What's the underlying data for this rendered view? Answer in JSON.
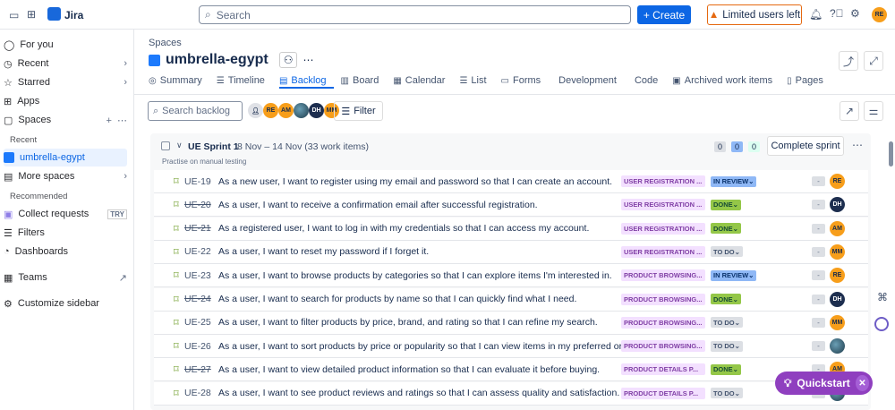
{
  "topbar": {
    "app": "Jira",
    "search_placeholder": "Search",
    "create": "Create",
    "limited": "Limited users left",
    "user_initials": "RE"
  },
  "sidebar": {
    "items": [
      {
        "label": "For you"
      },
      {
        "label": "Recent"
      },
      {
        "label": "Starred"
      },
      {
        "label": "Apps"
      },
      {
        "label": "Spaces"
      }
    ],
    "recent_header": "Recent",
    "space": "umbrella-egypt",
    "more_spaces": "More spaces",
    "recommended_header": "Recommended",
    "collect": "Collect requests",
    "try": "TRY",
    "filters": "Filters",
    "dashboards": "Dashboards",
    "teams": "Teams",
    "customize": "Customize sidebar"
  },
  "header": {
    "breadcrumb": "Spaces",
    "title": "umbrella-egypt"
  },
  "tabs": [
    {
      "label": "Summary"
    },
    {
      "label": "Timeline"
    },
    {
      "label": "Backlog"
    },
    {
      "label": "Board"
    },
    {
      "label": "Calendar"
    },
    {
      "label": "List"
    },
    {
      "label": "Forms"
    },
    {
      "label": "Development"
    },
    {
      "label": "Code"
    },
    {
      "label": "Archived work items"
    },
    {
      "label": "Pages"
    }
  ],
  "toolbar": {
    "search_placeholder": "Search backlog",
    "filter": "Filter",
    "avatars": [
      "RE",
      "AM",
      "",
      "DH",
      "MM"
    ]
  },
  "sprint": {
    "name": "UE Sprint 1",
    "dates": "8 Nov – 14 Nov (33 work items)",
    "goal": "Practise on manual testing",
    "counts": [
      "0",
      "0",
      "0"
    ],
    "complete": "Complete sprint"
  },
  "issues": [
    {
      "key": "UE-19",
      "summary": "As a new user, I want to register using my email and password so that I can create an account.",
      "epic": "USER REGISTRATION ...",
      "status": "IN REVIEW",
      "est": "-",
      "assignee": "RE",
      "done": false
    },
    {
      "key": "UE-20",
      "summary": "As a user, I want to receive a confirmation email after successful registration.",
      "epic": "USER REGISTRATION ...",
      "status": "DONE",
      "est": "-",
      "assignee": "DH",
      "done": true
    },
    {
      "key": "UE-21",
      "summary": "As a registered user, I want to log in with my credentials so that I can access my account.",
      "epic": "USER REGISTRATION ...",
      "status": "DONE",
      "est": "-",
      "assignee": "AM",
      "done": true
    },
    {
      "key": "UE-22",
      "summary": "As a user, I want to reset my password if I forget it.",
      "epic": "USER REGISTRATION ...",
      "status": "TO DO",
      "est": "-",
      "assignee": "MM",
      "done": false
    },
    {
      "key": "UE-23",
      "summary": "As a user, I want to browse products by categories so that I can explore items I'm interested in.",
      "epic": "PRODUCT BROWSING...",
      "status": "IN REVIEW",
      "est": "-",
      "assignee": "RE",
      "done": false
    },
    {
      "key": "UE-24",
      "summary": "As a user, I want to search for products by name so that I can quickly find what I need.",
      "epic": "PRODUCT BROWSING...",
      "status": "DONE",
      "est": "-",
      "assignee": "DH",
      "done": true
    },
    {
      "key": "UE-25",
      "summary": "As a user, I want to filter products by price, brand, and rating so that I can refine my search.",
      "epic": "PRODUCT BROWSING...",
      "status": "TO DO",
      "est": "-",
      "assignee": "MM",
      "done": false
    },
    {
      "key": "UE-26",
      "summary": "As a user, I want to sort products by price or popularity so that I can view items in my preferred or...",
      "epic": "PRODUCT BROWSING...",
      "status": "TO DO",
      "est": "-",
      "assignee": "",
      "done": false
    },
    {
      "key": "UE-27",
      "summary": "As a user, I want to view detailed product information so that I can evaluate it before buying.",
      "epic": "PRODUCT DETAILS P...",
      "status": "DONE",
      "est": "-",
      "assignee": "AM",
      "done": true
    },
    {
      "key": "UE-28",
      "summary": "As a user, I want to see product reviews and ratings so that I can assess quality and satisfaction.",
      "epic": "PRODUCT DETAILS P...",
      "status": "TO DO",
      "est": "-",
      "assignee": "",
      "done": false
    }
  ],
  "quickstart": "Quickstart",
  "colors": {
    "accent": "#0c66e4",
    "quickstart": "#8f3fbf",
    "epic": "#f3e0ff"
  }
}
